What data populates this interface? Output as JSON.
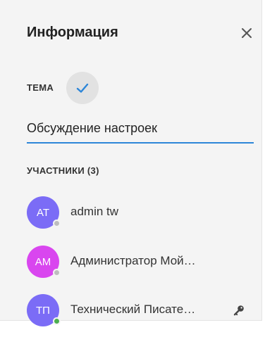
{
  "panel": {
    "title": "Информация",
    "close_icon": "close-icon"
  },
  "topic": {
    "label": "ТЕМА",
    "confirm_icon": "checkmark-icon",
    "value": "Обсуждение настроек",
    "accent_color": "#2d86d8"
  },
  "members": {
    "label": "УЧАСТНИКИ (3)",
    "items": [
      {
        "initials": "AT",
        "name": "admin tw",
        "avatar_color": "#7b6cf6",
        "status_color": "#bdbdbd",
        "role_icon": ""
      },
      {
        "initials": "AM",
        "name": "Администратор Мой…",
        "avatar_color": "#d946ef",
        "status_color": "#bdbdbd",
        "role_icon": ""
      },
      {
        "initials": "ТП",
        "name": "Технический Писате…",
        "avatar_color": "#7b6cf6",
        "status_color": "#4caf50",
        "role_icon": "key-icon"
      }
    ]
  }
}
